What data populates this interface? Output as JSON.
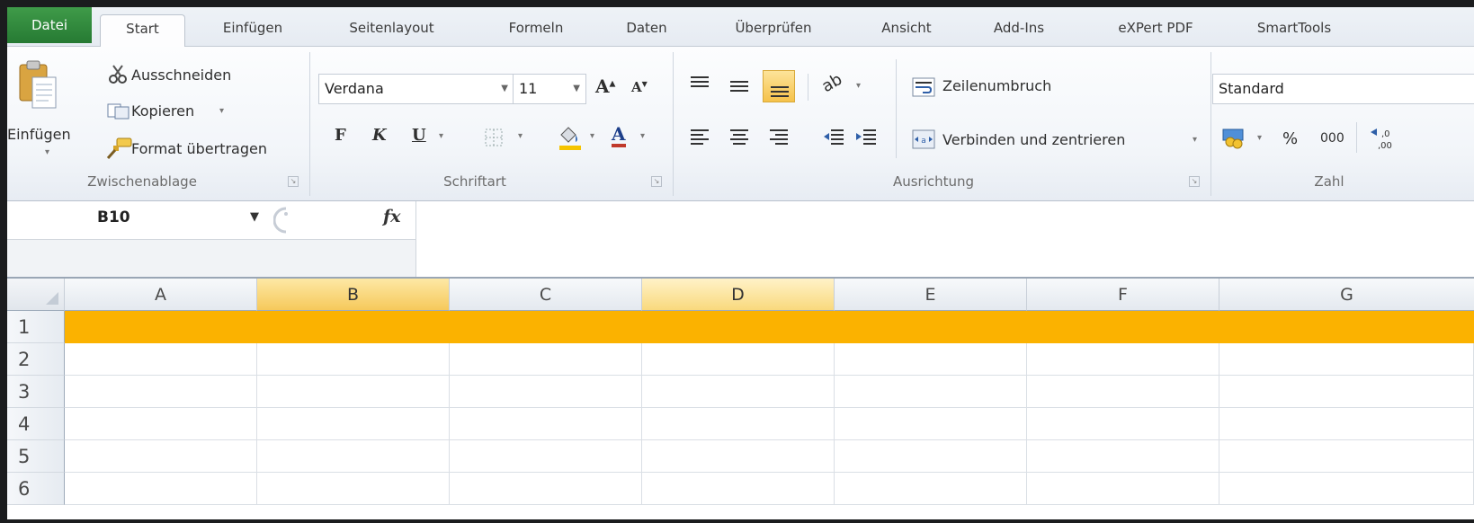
{
  "tabs": [
    {
      "label": "Datei"
    },
    {
      "label": "Start"
    },
    {
      "label": "Einfügen"
    },
    {
      "label": "Seitenlayout"
    },
    {
      "label": "Formeln"
    },
    {
      "label": "Daten"
    },
    {
      "label": "Überprüfen"
    },
    {
      "label": "Ansicht"
    },
    {
      "label": "Add-Ins"
    },
    {
      "label": "eXPert PDF"
    },
    {
      "label": "SmartTools"
    }
  ],
  "ribbon": {
    "clipboard": {
      "paste_label": "Einfügen",
      "cut_label": "Ausschneiden",
      "copy_label": "Kopieren",
      "format_painter_label": "Format übertragen",
      "group_label": "Zwischenablage"
    },
    "font": {
      "font_name": "Verdana",
      "font_size": "11",
      "bold_label": "F",
      "italic_label": "K",
      "underline_label": "U",
      "group_label": "Schriftart"
    },
    "alignment": {
      "wrap_text_label": "Zeilenumbruch",
      "merge_center_label": "Verbinden und zentrieren",
      "group_label": "Ausrichtung"
    },
    "number": {
      "format_value": "Standard",
      "percent_label": "%",
      "thousands_label": "000",
      "group_label": "Zahl"
    }
  },
  "formula_bar": {
    "name_box": "B10",
    "fx_label": "fx",
    "formula": ""
  },
  "grid": {
    "columns": [
      "A",
      "B",
      "C",
      "D",
      "E",
      "F",
      "G"
    ],
    "selected_columns": [
      "B",
      "D"
    ],
    "rows": [
      "1",
      "2",
      "3",
      "4",
      "5",
      "6"
    ],
    "highlighted_row": "1",
    "highlight_color": "#fbb200"
  },
  "colors": {
    "file_tab": "#2f8a3c",
    "row_highlight": "#fbb200",
    "selected_header": "#f6c95b"
  }
}
